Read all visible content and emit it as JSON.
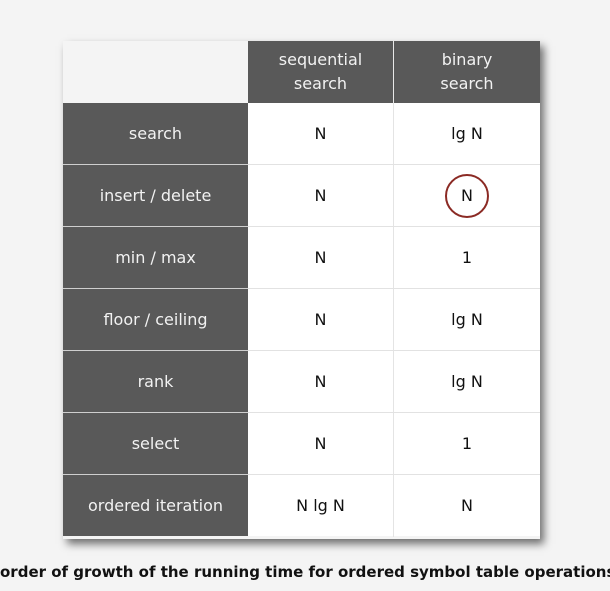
{
  "table": {
    "columns": [
      "sequential\nsearch",
      "binary\nsearch"
    ],
    "column_lines": [
      [
        "sequential",
        "search"
      ],
      [
        "binary",
        "search"
      ]
    ],
    "rows": [
      {
        "operation": "search",
        "sequential": "N",
        "binary": "lg N",
        "highlight": false
      },
      {
        "operation": "insert / delete",
        "sequential": "N",
        "binary": "N",
        "highlight": true
      },
      {
        "operation": "min / max",
        "sequential": "N",
        "binary": "1",
        "highlight": false
      },
      {
        "operation": "floor / ceiling",
        "sequential": "N",
        "binary": "lg N",
        "highlight": false
      },
      {
        "operation": "rank",
        "sequential": "N",
        "binary": "lg N",
        "highlight": false
      },
      {
        "operation": "select",
        "sequential": "N",
        "binary": "1",
        "highlight": false
      },
      {
        "operation": "ordered iteration",
        "sequential": "N lg N",
        "binary": "N",
        "highlight": false
      }
    ]
  },
  "colors": {
    "header_bg": "#595959",
    "highlight_circle": "#8b2a24"
  },
  "caption": "order of growth of the running time for ordered symbol table operations"
}
